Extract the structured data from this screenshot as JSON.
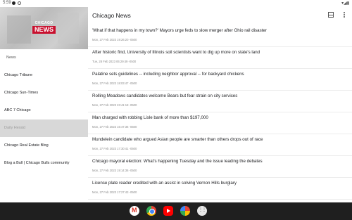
{
  "status_bar": {
    "time": "5:59"
  },
  "sidebar": {
    "logo_top": "CHICAGO",
    "logo_main": "NEWS",
    "header": "News",
    "items": [
      {
        "label": "Chicago Tribune"
      },
      {
        "label": "Chicago Sun-Times"
      },
      {
        "label": "ABC 7 Chicago"
      },
      {
        "label": "Daily Herald"
      },
      {
        "label": "Chicago Real Estate Blog"
      },
      {
        "label": "Blog a Bull | Chicago Bulls community"
      }
    ]
  },
  "main": {
    "title": "Chicago News",
    "articles": [
      {
        "headline": "'What if that happens in my town?' Mayors urge feds to slow merger after Ohio rail disaster",
        "date": "Mon, 27 Feb 2023 19:26:20 -0500"
      },
      {
        "headline": "After historic find, University of Illinois soil scientists want to dig up more on state's land",
        "date": "Tue, 28 Feb 2023 06:29:49 -0500"
      },
      {
        "headline": "Palatine sets guidelines -- including neighbor approval -- for backyard chickens",
        "date": "Mon, 27 Feb 2023 18:03:47 -0500"
      },
      {
        "headline": "Rolling Meadows candidates welcome Bears but fear strain on city services",
        "date": "Mon, 27 Feb 2023 23:41:18 -0500"
      },
      {
        "headline": "Man charged with robbing Lisle bank of more than $197,000",
        "date": "Mon, 27 Feb 2023 16:47:36 -0500"
      },
      {
        "headline": "Mundelein candidate who argued Asian people are smarter than others drops out of race",
        "date": "Mon, 27 Feb 2023 17:30:41 -0500"
      },
      {
        "headline": "Chicago mayoral election: What's happening Tuesday and the issue leading the debates",
        "date": "Mon, 27 Feb 2023 19:14:36 -0500"
      },
      {
        "headline": "License plate reader credited with an assist in solving Vernon Hills burglary",
        "date": "Mon, 27 Feb 2023 17:27:43 -0500"
      }
    ]
  },
  "dock": {
    "apps": [
      "gmail-icon",
      "chrome-icon",
      "youtube-icon",
      "photos-icon",
      "app-drawer-icon"
    ]
  }
}
